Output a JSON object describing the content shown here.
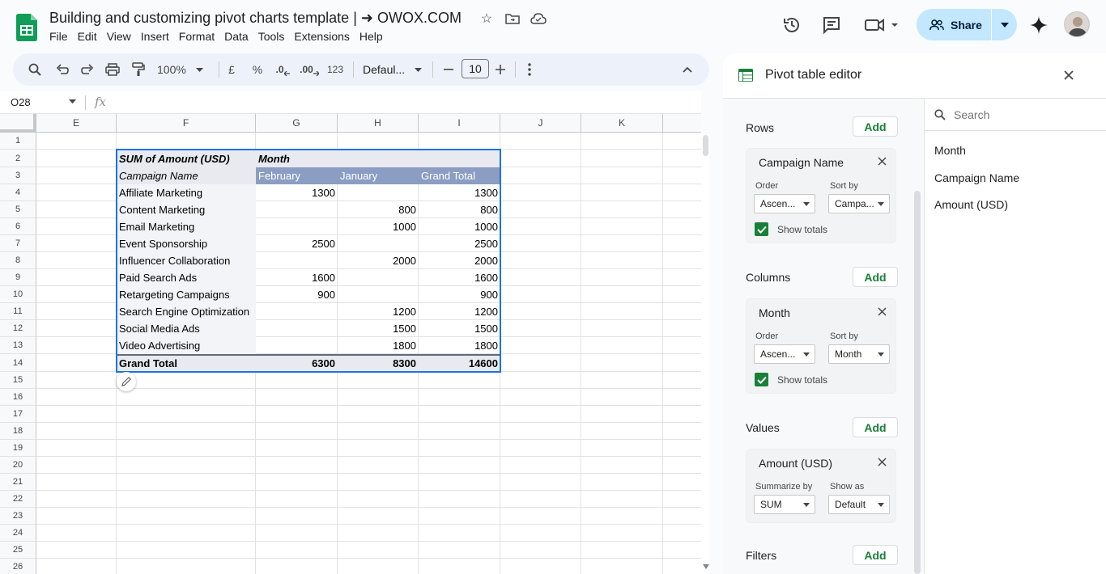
{
  "header": {
    "doc_title": "Building and customizing pivot charts template | ➜ OWOX.COM",
    "menus": [
      "File",
      "Edit",
      "View",
      "Insert",
      "Format",
      "Data",
      "Tools",
      "Extensions",
      "Help"
    ],
    "share_label": "Share"
  },
  "toolbar": {
    "zoom": "100%",
    "currency": "£",
    "percent": "%",
    "dec_decrease": ".0",
    "dec_increase": ".00",
    "number_format": "123",
    "font": "Defaul...",
    "font_size": "10"
  },
  "formula_bar": {
    "cell_ref": "O28",
    "fx": "fx"
  },
  "grid": {
    "columns": [
      "E",
      "F",
      "G",
      "H",
      "I",
      "J",
      "K"
    ],
    "rows": [
      "1",
      "2",
      "3",
      "4",
      "5",
      "6",
      "7",
      "8",
      "9",
      "10",
      "11",
      "12",
      "13",
      "14",
      "15",
      "16",
      "17",
      "18",
      "19",
      "20",
      "21",
      "22",
      "23",
      "24",
      "25",
      "26"
    ]
  },
  "pivot": {
    "value_header": "SUM of Amount (USD)",
    "col_field": "Month",
    "row_field": "Campaign Name",
    "col_headers": [
      "February",
      "January",
      "Grand Total"
    ],
    "rows": [
      {
        "name": "Affiliate Marketing",
        "feb": "1300",
        "jan": "",
        "total": "1300"
      },
      {
        "name": "Content Marketing",
        "feb": "",
        "jan": "800",
        "total": "800"
      },
      {
        "name": "Email Marketing",
        "feb": "",
        "jan": "1000",
        "total": "1000"
      },
      {
        "name": "Event Sponsorship",
        "feb": "2500",
        "jan": "",
        "total": "2500"
      },
      {
        "name": "Influencer Collaboration",
        "feb": "",
        "jan": "2000",
        "total": "2000"
      },
      {
        "name": "Paid Search Ads",
        "feb": "1600",
        "jan": "",
        "total": "1600"
      },
      {
        "name": "Retargeting Campaigns",
        "feb": "900",
        "jan": "",
        "total": "900"
      },
      {
        "name": "Search Engine Optimization",
        "feb": "",
        "jan": "1200",
        "total": "1200"
      },
      {
        "name": "Social Media Ads",
        "feb": "",
        "jan": "1500",
        "total": "1500"
      },
      {
        "name": "Video Advertising",
        "feb": "",
        "jan": "1800",
        "total": "1800"
      }
    ],
    "grand_total": {
      "name": "Grand Total",
      "feb": "6300",
      "jan": "8300",
      "total": "14600"
    }
  },
  "editor": {
    "title": "Pivot table editor",
    "add_label": "Add",
    "rows_label": "Rows",
    "columns_label": "Columns",
    "values_label": "Values",
    "filters_label": "Filters",
    "order_label": "Order",
    "sort_by_label": "Sort by",
    "summarize_label": "Summarize by",
    "show_as_label": "Show as",
    "show_totals_label": "Show totals",
    "row_card": {
      "title": "Campaign Name",
      "order": "Ascen...",
      "sort_by": "Campa..."
    },
    "col_card": {
      "title": "Month",
      "order": "Ascen...",
      "sort_by": "Month"
    },
    "value_card": {
      "title": "Amount (USD)",
      "summarize": "SUM",
      "show_as": "Default"
    },
    "search_placeholder": "Search",
    "fields": [
      "Month",
      "Campaign Name",
      "Amount (USD)"
    ]
  },
  "colors": {
    "accent_green": "#188038",
    "pivot_header_blue": "#8b9dc3",
    "selection_blue": "#1a73e8",
    "share_bg": "#c2e7ff"
  }
}
